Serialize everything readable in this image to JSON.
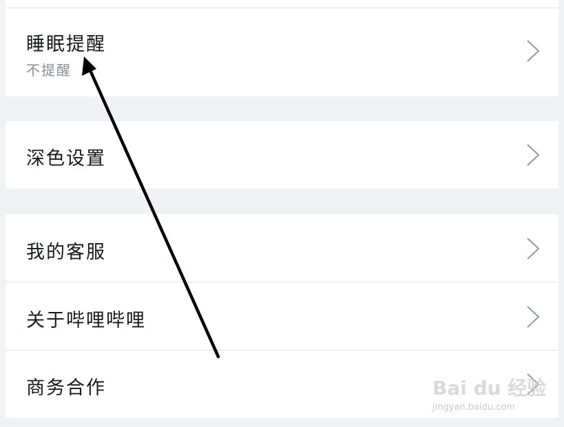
{
  "settings": {
    "sleep_reminder": {
      "label": "睡眠提醒",
      "value": "不提醒"
    },
    "dark_mode": {
      "label": "深色设置"
    },
    "customer_service": {
      "label": "我的客服"
    },
    "about": {
      "label": "关于哔哩哔哩"
    },
    "business": {
      "label": "商务合作"
    }
  },
  "icons": {
    "chevron": "chevron-right-icon",
    "annotation_arrow": "arrow-pointer-icon"
  },
  "watermark": {
    "brand": "Bai du 经验",
    "url": "jingyan.baidu.com"
  },
  "colors": {
    "row_bg": "#ffffff",
    "section_gap": "#f1f2f4",
    "label_text": "#18191c",
    "sub_text": "#8a8d93",
    "chevron": "#9a9da3",
    "arrow": "#000000"
  }
}
